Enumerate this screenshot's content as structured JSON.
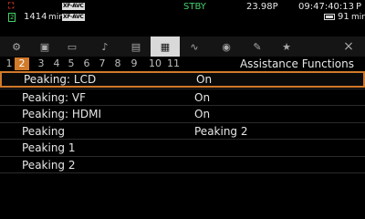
{
  "status": {
    "rec_icon": "camera-rec-icon",
    "card_icon": "sd-card-icon",
    "card_label": "2",
    "format_top": "XF-AVC",
    "format_bottom": "XF-AVC",
    "remaining_time": "1414",
    "remaining_unit": "min",
    "mode": "STBY",
    "frame_rate": "23.98P",
    "timecode": "09:47:40:13",
    "timecode_suffix": "P",
    "battery_time": "91",
    "battery_unit": "min",
    "mode_color": "#45d16a"
  },
  "tabs": [
    {
      "icon": "camera-settings-icon",
      "glyph": "⚙",
      "active": false
    },
    {
      "icon": "custom-picture-icon",
      "glyph": "▣",
      "active": false
    },
    {
      "icon": "recording-setup-icon",
      "glyph": "▭",
      "active": false
    },
    {
      "icon": "audio-setup-icon",
      "glyph": "♪",
      "active": false
    },
    {
      "icon": "monitoring-icon",
      "glyph": "▤",
      "active": false
    },
    {
      "icon": "assistance-functions-icon",
      "glyph": "▦",
      "active": true
    },
    {
      "icon": "waveform-icon",
      "glyph": "∿",
      "active": false
    },
    {
      "icon": "network-icon",
      "glyph": "◉",
      "active": false
    },
    {
      "icon": "system-setup-icon",
      "glyph": "✎",
      "active": false
    },
    {
      "icon": "my-menu-icon",
      "glyph": "★",
      "active": false
    }
  ],
  "close_label": "×",
  "pages": [
    "1",
    "2",
    "3",
    "4",
    "5",
    "6",
    "7",
    "8",
    "9",
    "10",
    "11"
  ],
  "active_page": "2",
  "section_title": "Assistance Functions",
  "accent_color": "#d07a2a",
  "menu_items": [
    {
      "label": "Peaking: LCD",
      "value": "On",
      "selected": true
    },
    {
      "label": "Peaking: VF",
      "value": "On",
      "selected": false
    },
    {
      "label": "Peaking: HDMI",
      "value": "On",
      "selected": false
    },
    {
      "label": "Peaking",
      "value": "Peaking 2",
      "selected": false
    },
    {
      "label": "Peaking 1",
      "value": "",
      "selected": false
    },
    {
      "label": "Peaking 2",
      "value": "",
      "selected": false
    }
  ]
}
